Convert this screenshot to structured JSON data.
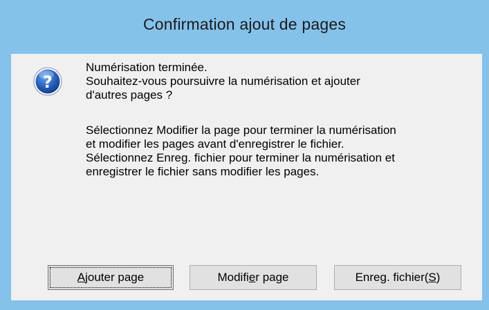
{
  "dialog": {
    "title": "Confirmation ajout de pages",
    "icon": "question-icon",
    "message": {
      "line1": "Numérisation terminée.",
      "line2": "Souhaitez-vous poursuivre la numérisation et ajouter",
      "line3": "d'autres pages ?",
      "para2_line1": "Sélectionnez Modifier la page pour terminer la numérisation",
      "para2_line2": "et modifier les pages avant d'enregistrer le fichier.",
      "para2_line3": "Sélectionnez Enreg. fichier pour terminer la numérisation et",
      "para2_line4": "enregistrer le fichier sans modifier les pages."
    },
    "buttons": {
      "add": {
        "label_pre": "",
        "label_mnemonic": "A",
        "label_post": "jouter page"
      },
      "modify": {
        "label_pre": "Modifi",
        "label_mnemonic": "e",
        "label_post": "r page"
      },
      "save": {
        "label_pre": "Enreg. fichier(",
        "label_mnemonic": "S",
        "label_post": ")"
      }
    },
    "colors": {
      "frame": "#85c2ea",
      "client": "#f0f0f0",
      "button_face": "#e1e1e1",
      "icon_blue": "#1f5fb8"
    }
  }
}
